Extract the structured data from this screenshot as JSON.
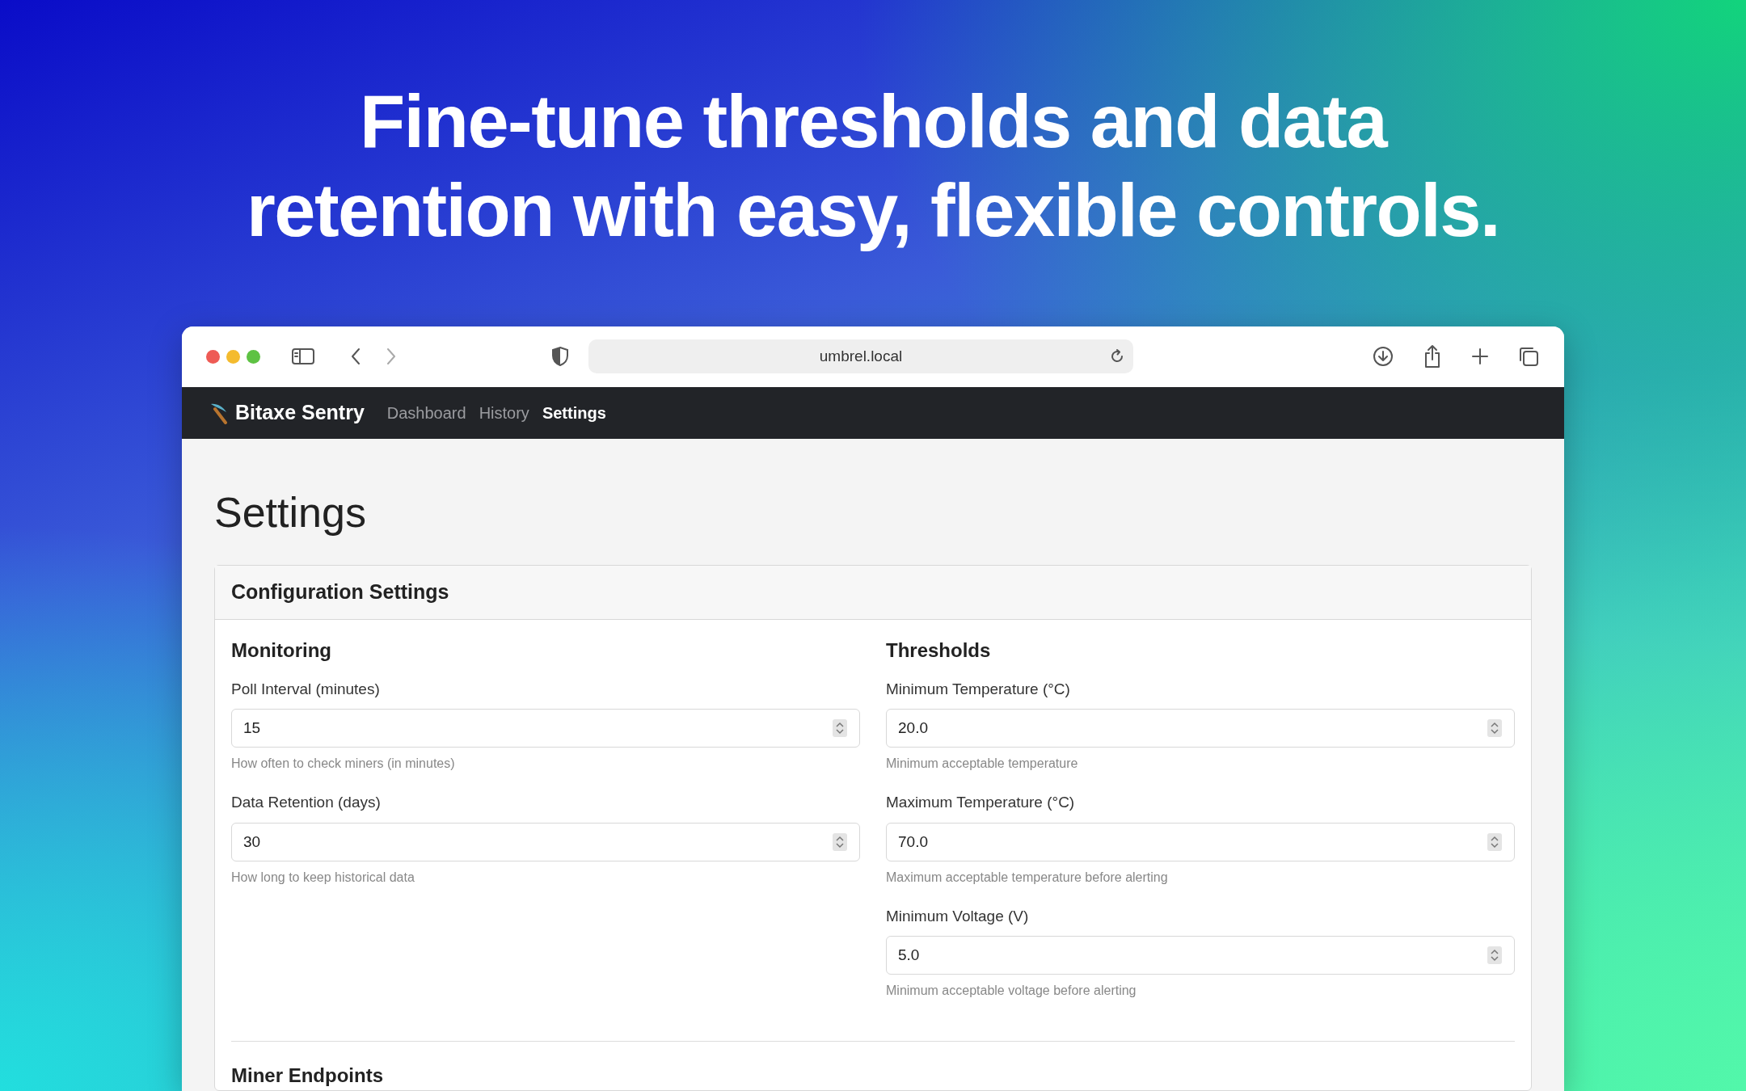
{
  "headline": "Fine-tune thresholds and data retention with easy, flexible controls.",
  "browser": {
    "url": "umbrel.local"
  },
  "navbar": {
    "brand": "Bitaxe Sentry",
    "links": [
      {
        "label": "Dashboard",
        "selected": false
      },
      {
        "label": "History",
        "selected": false
      },
      {
        "label": "Settings",
        "selected": true
      }
    ]
  },
  "page_title": "Settings",
  "card": {
    "header": "Configuration Settings",
    "sections": [
      {
        "title": "Monitoring",
        "fields": [
          {
            "label": "Poll Interval (minutes)",
            "value": "15",
            "help": "How often to check miners (in minutes)"
          },
          {
            "label": "Data Retention (days)",
            "value": "30",
            "help": "How long to keep historical data"
          }
        ]
      },
      {
        "title": "Thresholds",
        "fields": [
          {
            "label": "Minimum Temperature (°C)",
            "value": "20.0",
            "help": "Minimum acceptable temperature"
          },
          {
            "label": "Maximum Temperature (°C)",
            "value": "70.0",
            "help": "Maximum acceptable temperature before alerting"
          },
          {
            "label": "Minimum Voltage (V)",
            "value": "5.0",
            "help": "Minimum acceptable voltage before alerting"
          }
        ]
      }
    ],
    "next_section": "Miner Endpoints"
  }
}
